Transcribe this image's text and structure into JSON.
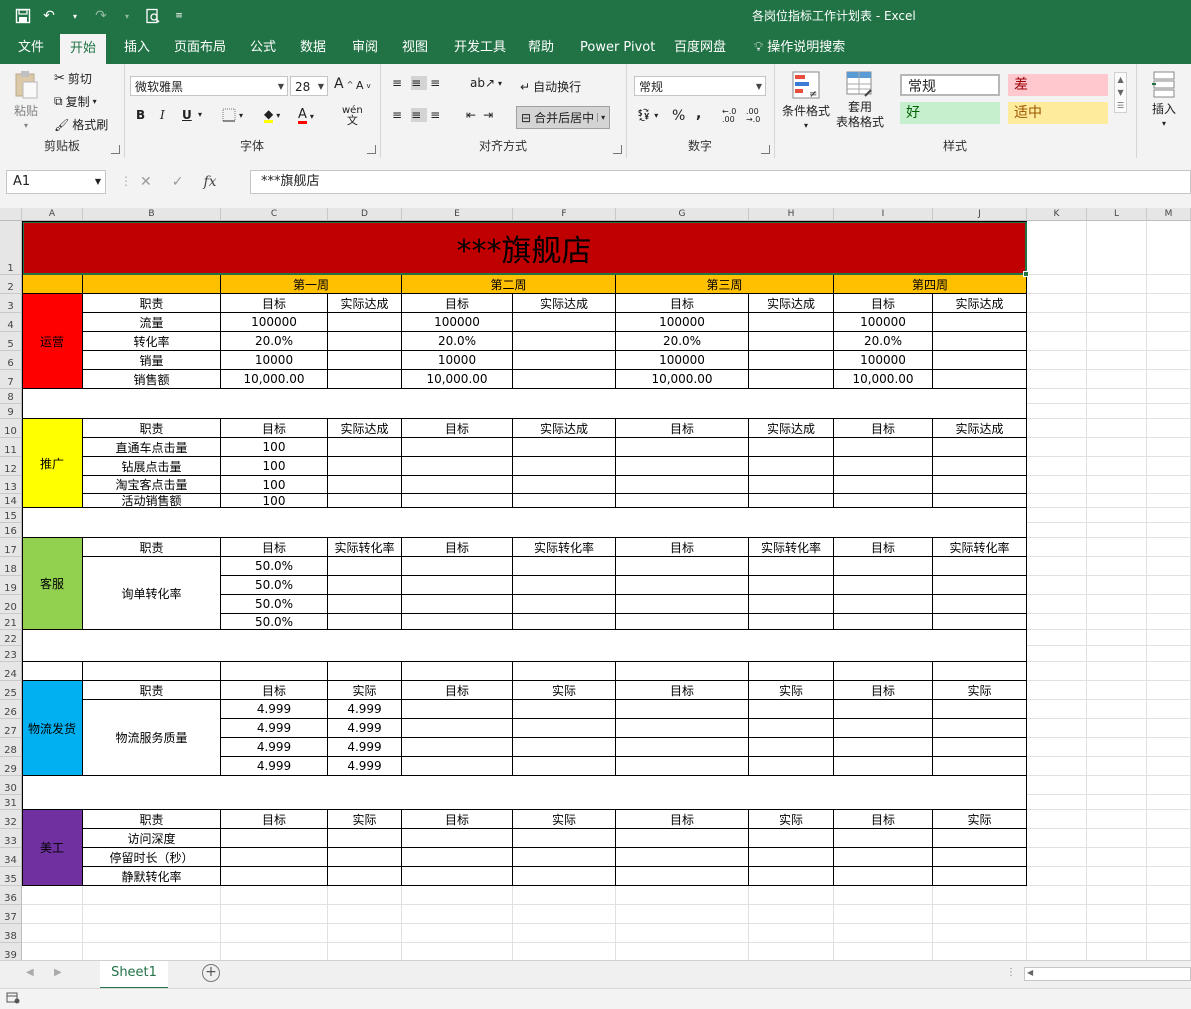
{
  "window": {
    "title": "各岗位指标工作计划表  -  Excel"
  },
  "tabs": [
    "文件",
    "开始",
    "插入",
    "页面布局",
    "公式",
    "数据",
    "审阅",
    "视图",
    "开发工具",
    "帮助",
    "Power Pivot",
    "百度网盘",
    "操作说明搜索"
  ],
  "ribbon": {
    "clipboard": {
      "paste": "粘贴",
      "cut": "剪切",
      "copy": "复制",
      "painter": "格式刷",
      "label": "剪贴板"
    },
    "font": {
      "name": "微软雅黑",
      "size": "28",
      "grow": "A",
      "shrink": "A",
      "bold": "B",
      "italic": "I",
      "underline": "U",
      "wen": "wén",
      "label": "字体"
    },
    "align": {
      "wrap": "自动换行",
      "merge": "合并后居中",
      "label": "对齐方式"
    },
    "number": {
      "format": "常规",
      "percent": "%",
      "comma": ",",
      "inc": "←.0 .00",
      "dec": ".00 →.0",
      "label": "数字"
    },
    "styles": {
      "cond": "条件格式",
      "table_1": "套用",
      "table_2": "表格格式",
      "normal": "常规",
      "bad": "差",
      "good": "好",
      "neutral": "适中",
      "label": "样式"
    },
    "cells": {
      "insert": "插入"
    }
  },
  "formula": {
    "namebox": "A1",
    "fx": "fx",
    "content": "***旗舰店"
  },
  "colors": {
    "green": "#217346",
    "title_red": "#c00000",
    "header_gold": "#ffc000",
    "ops": "#ff0000",
    "promo": "#ffff00",
    "cs": "#92d050",
    "logistics": "#00b0f0",
    "art": "#7030a0",
    "bad_bg": "#ffc7ce",
    "bad_fg": "#9c0006",
    "good_bg": "#c6efce",
    "good_fg": "#006100",
    "neutral_bg": "#ffeb9c",
    "neutral_fg": "#9c5700"
  },
  "columns": [
    "A",
    "B",
    "C",
    "D",
    "E",
    "F",
    "G",
    "H",
    "I",
    "J",
    "K",
    "L",
    "M"
  ],
  "rows": [
    "1",
    "2",
    "3",
    "4",
    "5",
    "6",
    "7",
    "8",
    "9",
    "10",
    "11",
    "12",
    "13",
    "14",
    "15",
    "16",
    "17",
    "18",
    "19",
    "20",
    "21",
    "22",
    "23",
    "24",
    "25",
    "26",
    "27",
    "28",
    "29",
    "30",
    "31",
    "32",
    "33",
    "34",
    "35",
    "36",
    "37",
    "38",
    "39"
  ],
  "sheet": {
    "title": "***旗舰店",
    "weeks": [
      "第一周",
      "第二周",
      "第三周",
      "第四周"
    ],
    "sections": [
      {
        "name": "运营",
        "head": [
          "职责",
          "目标",
          "实际达成",
          "目标",
          "实际达成",
          "目标",
          "实际达成",
          "目标",
          "实际达成"
        ],
        "items": [
          {
            "label": "流量",
            "t": [
              "100000",
              "100000",
              "100000",
              "100000"
            ],
            "a": [
              "",
              "",
              "",
              ""
            ]
          },
          {
            "label": "转化率",
            "t": [
              "20.0%",
              "20.0%",
              "20.0%",
              "20.0%"
            ],
            "a": [
              "",
              "",
              "",
              ""
            ]
          },
          {
            "label": "销量",
            "t": [
              "10000",
              "10000",
              "100000",
              "100000"
            ],
            "a": [
              "",
              "",
              "",
              ""
            ]
          },
          {
            "label": "销售额",
            "t": [
              "10,000.00",
              "10,000.00",
              "10,000.00",
              "10,000.00"
            ],
            "a": [
              "",
              "",
              "",
              ""
            ]
          }
        ]
      },
      {
        "name": "推广",
        "head": [
          "职责",
          "目标",
          "实际达成",
          "目标",
          "实际达成",
          "目标",
          "实际达成",
          "目标",
          "实际达成"
        ],
        "items": [
          {
            "label": "直通车点击量",
            "t": [
              "100",
              "",
              "",
              ""
            ],
            "a": [
              "",
              "",
              "",
              ""
            ]
          },
          {
            "label": "钻展点击量",
            "t": [
              "100",
              "",
              "",
              ""
            ],
            "a": [
              "",
              "",
              "",
              ""
            ]
          },
          {
            "label": "淘宝客点击量",
            "t": [
              "100",
              "",
              "",
              ""
            ],
            "a": [
              "",
              "",
              "",
              ""
            ]
          },
          {
            "label": "活动销售额",
            "t": [
              "100",
              "",
              "",
              ""
            ],
            "a": [
              "",
              "",
              "",
              ""
            ]
          }
        ]
      },
      {
        "name": "客服",
        "head": [
          "职责",
          "目标",
          "实际转化率",
          "目标",
          "实际转化率",
          "目标",
          "实际转化率",
          "目标",
          "实际转化率"
        ],
        "merged_label": "询单转化率",
        "items": [
          {
            "t": [
              "50.0%",
              "",
              "",
              ""
            ],
            "a": [
              "",
              "",
              "",
              ""
            ]
          },
          {
            "t": [
              "50.0%",
              "",
              "",
              ""
            ],
            "a": [
              "",
              "",
              "",
              ""
            ]
          },
          {
            "t": [
              "50.0%",
              "",
              "",
              ""
            ],
            "a": [
              "",
              "",
              "",
              ""
            ]
          },
          {
            "t": [
              "50.0%",
              "",
              "",
              ""
            ],
            "a": [
              "",
              "",
              "",
              ""
            ]
          }
        ]
      },
      {
        "name": "物流发货",
        "head": [
          "职责",
          "目标",
          "实际",
          "目标",
          "实际",
          "目标",
          "实际",
          "目标",
          "实际"
        ],
        "merged_label": "物流服务质量",
        "items": [
          {
            "t": [
              "4.999",
              "",
              "",
              ""
            ],
            "a": [
              "4.999",
              "",
              "",
              ""
            ]
          },
          {
            "t": [
              "4.999",
              "",
              "",
              ""
            ],
            "a": [
              "4.999",
              "",
              "",
              ""
            ]
          },
          {
            "t": [
              "4.999",
              "",
              "",
              ""
            ],
            "a": [
              "4.999",
              "",
              "",
              ""
            ]
          },
          {
            "t": [
              "4.999",
              "",
              "",
              ""
            ],
            "a": [
              "4.999",
              "",
              "",
              ""
            ]
          }
        ]
      },
      {
        "name": "美工",
        "head": [
          "职责",
          "目标",
          "实际",
          "目标",
          "实际",
          "目标",
          "实际",
          "目标",
          "实际"
        ],
        "items": [
          {
            "label": "访问深度",
            "t": [
              "",
              "",
              "",
              ""
            ],
            "a": [
              "",
              "",
              "",
              ""
            ]
          },
          {
            "label": "停留时长（秒）",
            "t": [
              "",
              "",
              "",
              ""
            ],
            "a": [
              "",
              "",
              "",
              ""
            ]
          },
          {
            "label": "静默转化率",
            "t": [
              "",
              "",
              "",
              ""
            ],
            "a": [
              "",
              "",
              "",
              ""
            ]
          }
        ]
      }
    ]
  },
  "sheettabs": [
    "Sheet1"
  ]
}
